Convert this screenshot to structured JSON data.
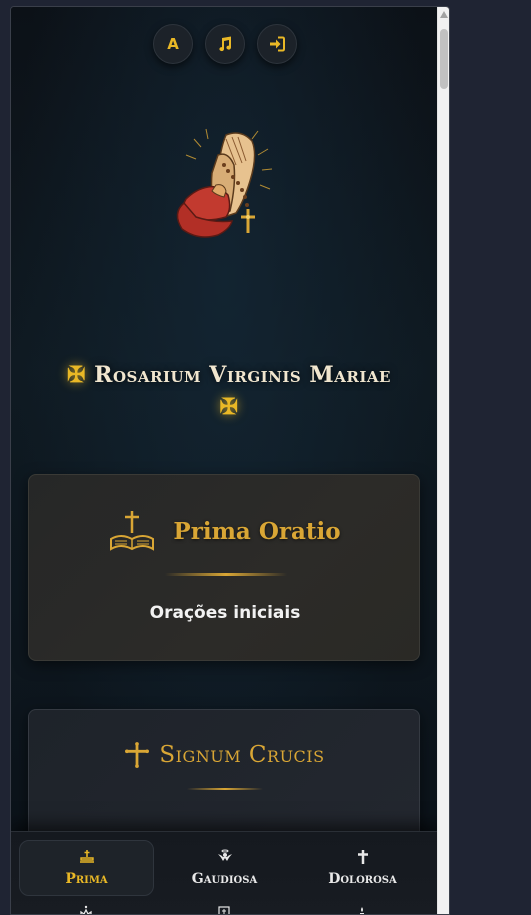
{
  "top_buttons": [
    {
      "name": "font-size",
      "label": "A"
    },
    {
      "name": "music",
      "icon": "music-note-icon"
    },
    {
      "name": "login",
      "icon": "sign-in-icon"
    }
  ],
  "hero": {
    "icon": "praying-hands-rosary-icon"
  },
  "title": {
    "prefix": "✠",
    "text": "Rosarium Virginis Mariae",
    "suffix": "✠"
  },
  "cards": [
    {
      "icon": "bible-cross-icon",
      "title": "Prima Oratio",
      "subtitle": "Orações iniciais"
    },
    {
      "icon": "cross-icon",
      "title": "Signum Crucis"
    }
  ],
  "nav": [
    {
      "label": "Prima",
      "icon": "altar-icon",
      "active": true
    },
    {
      "label": "Gaudiosa",
      "icon": "angel-icon",
      "active": false
    },
    {
      "label": "Dolorosa",
      "icon": "cross-icon",
      "active": false
    }
  ],
  "colors": {
    "accent": "#e9b826",
    "gold": "#d9a635",
    "background": "#0b0f14"
  }
}
